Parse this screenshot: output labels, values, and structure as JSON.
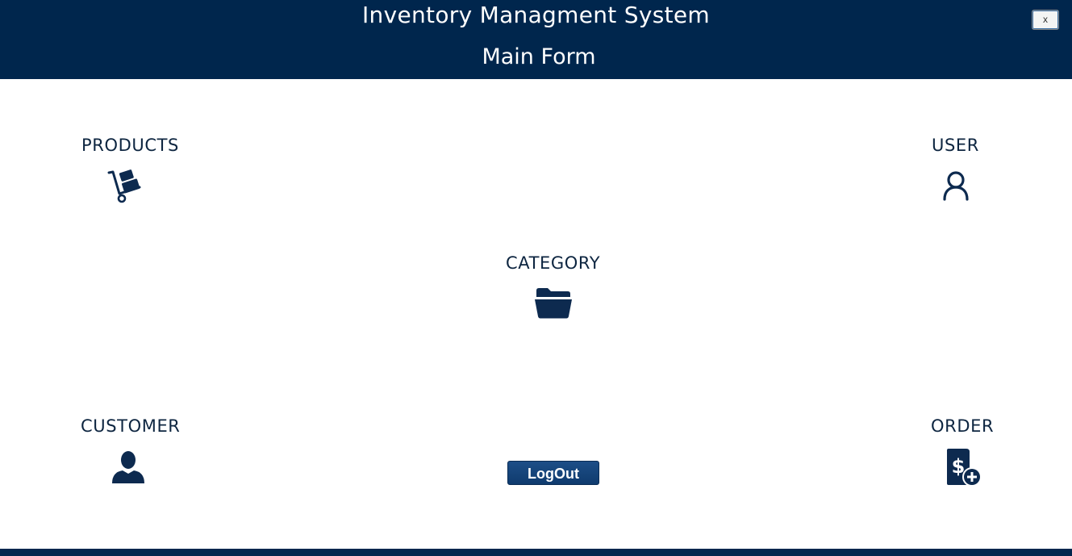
{
  "header": {
    "title": "Inventory Managment System",
    "subtitle": "Main Form",
    "close_label": "x"
  },
  "tiles": {
    "products": {
      "label": "PRODUCTS",
      "icon": "hand-truck-icon"
    },
    "user": {
      "label": "USER",
      "icon": "user-outline-icon"
    },
    "category": {
      "label": "CATEGORY",
      "icon": "folder-open-icon"
    },
    "customer": {
      "label": "CUSTOMER",
      "icon": "person-icon"
    },
    "order": {
      "label": "ORDER",
      "icon": "invoice-add-icon"
    }
  },
  "logout_label": "LogOut",
  "colors": {
    "header_bg": "#00264d",
    "accent": "#0d2a4f",
    "button_bg": "#1a4a80"
  }
}
